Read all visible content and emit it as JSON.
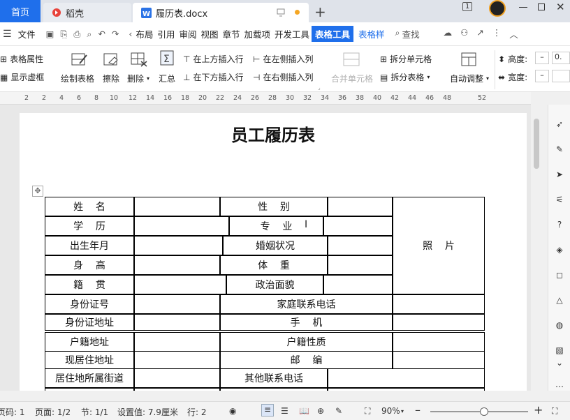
{
  "tabs": {
    "home": "首页",
    "daoke": "稻壳",
    "doc": "履历表.docx",
    "window_badge": "1"
  },
  "menu": {
    "file": "文件",
    "items": [
      "布局",
      "引用",
      "审阅",
      "视图",
      "章节",
      "加载项",
      "开发工具"
    ],
    "active": "表格工具",
    "style_tab": "表格样",
    "search": "查找"
  },
  "ribbon": {
    "table_props": "表格属性",
    "show_gridlines": "显示虚框",
    "draw_table": "绘制表格",
    "eraser": "擦除",
    "delete": "删除",
    "summary": "汇总",
    "insert_above": "在上方插入行",
    "insert_below": "在下方插入行",
    "insert_left": "在左侧插入列",
    "insert_right": "在右侧插入列",
    "merge_cells": "合并单元格",
    "split_cells": "拆分单元格",
    "split_table": "拆分表格",
    "auto_fit": "自动调整",
    "height_label": "高度:",
    "width_label": "宽度:",
    "height_value": "0.",
    "minus": "–"
  },
  "ruler": [
    "2",
    "2",
    "4",
    "6",
    "8",
    "10",
    "12",
    "14",
    "16",
    "18",
    "20",
    "22",
    "24",
    "26",
    "28",
    "30",
    "32",
    "34",
    "36",
    "38",
    "40",
    "42",
    "44",
    "46",
    "48",
    "52"
  ],
  "document": {
    "title": "员工履历表",
    "cells": {
      "name": "姓    名",
      "gender": "性    别",
      "education": "学    历",
      "major": "专    业",
      "birth": "出生年月",
      "marital": "婚姻状况",
      "height": "身    高",
      "weight": "体    重",
      "origin": "籍    贯",
      "politics": "政治面貌",
      "photo": "照    片",
      "id_no": "身份证号",
      "family_phone": "家庭联系电话",
      "id_addr": "身份证地址",
      "mobile": "手    机",
      "hukou_addr": "户籍地址",
      "hukou_type": "户籍性质",
      "cur_addr": "现居住地址",
      "postcode": "邮    编",
      "street": "居住地所属街道",
      "other_phone": "其他联系电话"
    }
  },
  "status": {
    "page_num": "页码: 1",
    "pages": "页面: 1/2",
    "section": "节: 1/1",
    "setting": "设置值: 7.9厘米",
    "row": "行: 2",
    "zoom": "90%",
    "zoom_minus": "–",
    "zoom_plus": "+"
  },
  "zoom_level_fraction": 0.55
}
